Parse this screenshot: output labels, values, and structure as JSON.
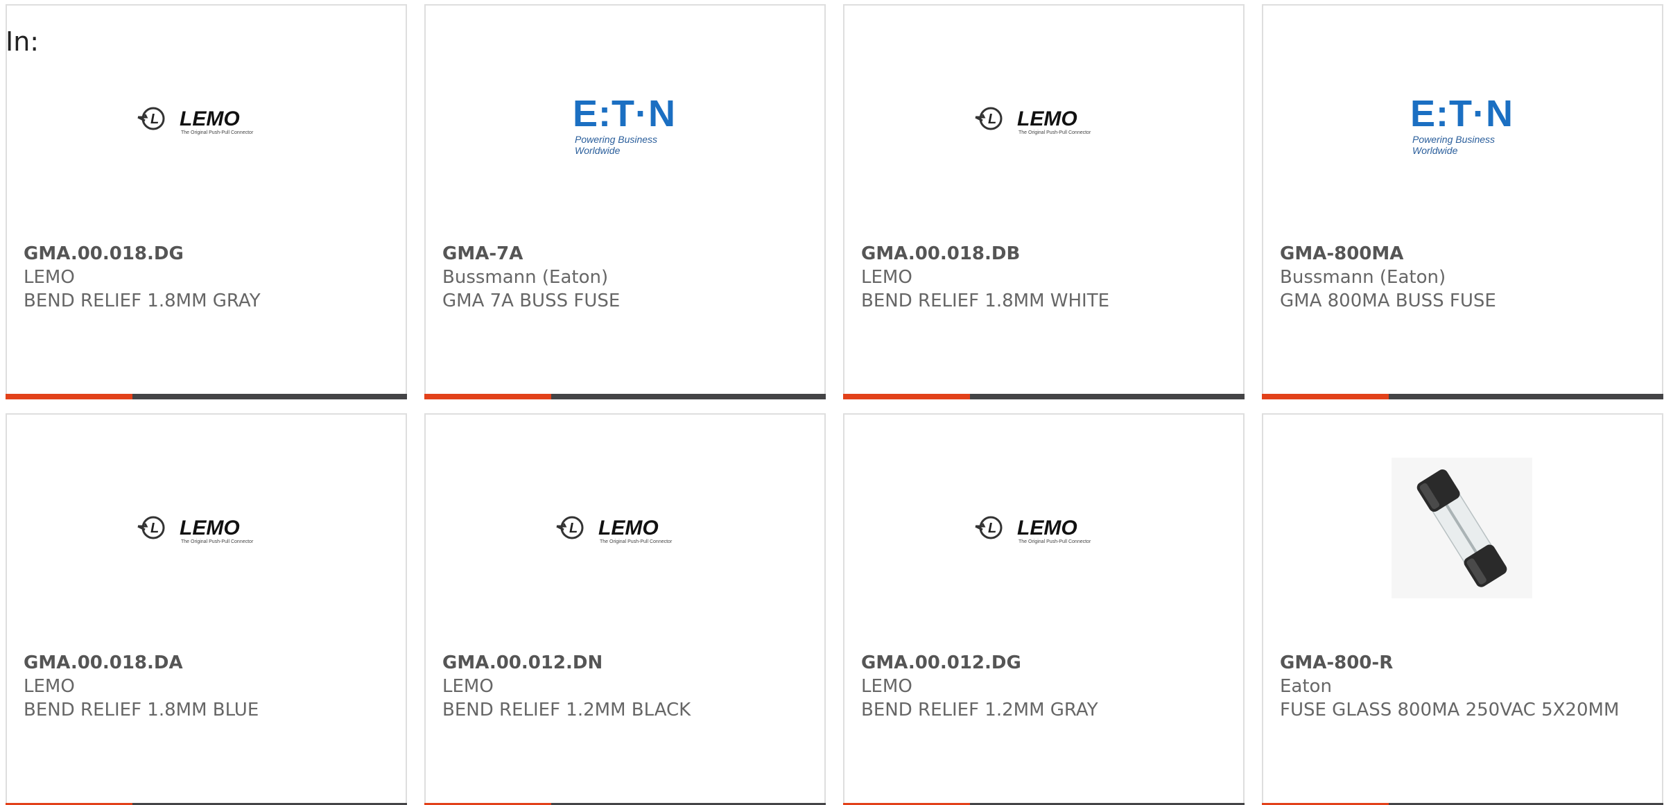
{
  "filter": {
    "label": "In:"
  },
  "colors": {
    "accent": "#e2411a",
    "bar_dark": "#444446",
    "border": "#dedede",
    "text": "#666666",
    "eaton_blue": "#1b6fc2"
  },
  "logos": {
    "lemo": {
      "word": "LEMO",
      "tagline": "The Original Push-Pull Connector"
    },
    "eaton": {
      "word": "E:T·N",
      "tagline": "Powering Business Worldwide"
    }
  },
  "products": [
    {
      "part_number": "GMA.00.018.DG",
      "brand": "LEMO",
      "description": "BEND RELIEF 1.8MM GRAY",
      "image": "lemo-logo"
    },
    {
      "part_number": "GMA-7A",
      "brand": "Bussmann (Eaton)",
      "description": "GMA 7A BUSS FUSE",
      "image": "eaton-logo"
    },
    {
      "part_number": "GMA.00.018.DB",
      "brand": "LEMO",
      "description": "BEND RELIEF 1.8MM WHITE",
      "image": "lemo-logo"
    },
    {
      "part_number": "GMA-800MA",
      "brand": "Bussmann (Eaton)",
      "description": "GMA 800MA BUSS FUSE",
      "image": "eaton-logo"
    },
    {
      "part_number": "GMA.00.018.DA",
      "brand": "LEMO",
      "description": "BEND RELIEF 1.8MM BLUE",
      "image": "lemo-logo"
    },
    {
      "part_number": "GMA.00.012.DN",
      "brand": "LEMO",
      "description": "BEND RELIEF 1.2MM BLACK",
      "image": "lemo-logo"
    },
    {
      "part_number": "GMA.00.012.DG",
      "brand": "LEMO",
      "description": "BEND RELIEF 1.2MM GRAY",
      "image": "lemo-logo"
    },
    {
      "part_number": "GMA-800-R",
      "brand": "Eaton",
      "description": "FUSE GLASS 800MA 250VAC 5X20MM",
      "image": "glass-fuse-photo"
    }
  ]
}
